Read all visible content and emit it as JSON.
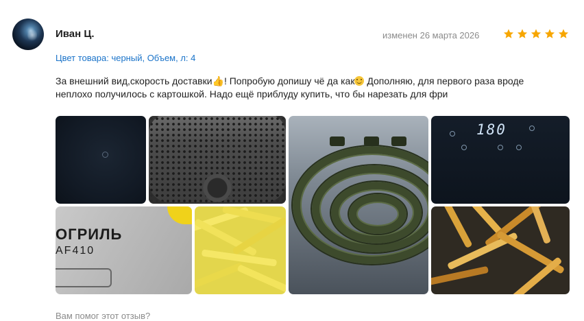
{
  "review": {
    "author": "Иван Ц.",
    "edited": "изменен 26 марта 2026",
    "rating": 5,
    "variant": "Цвет товара: черный, Объем, л: 4",
    "text_part1": "За внешний вид,скорость доставки",
    "text_part2": "! Попробую допишу чё да как",
    "text_part3": " Дополняю, для первого раза вроде неплохо получилось с картошкой. Надо ещё приблуду купить, что бы нарезать для фри",
    "emoji_1": "👍",
    "emoji_2": "smiling-face"
  },
  "photos": {
    "display_digits": "180",
    "brand_text": "ОГРИЛЬ",
    "model_text": "AF410"
  },
  "footer": {
    "helpful_question": "Вам помог этот отзыв?"
  },
  "colors": {
    "star": "#f7a600",
    "link": "#1a73c9",
    "muted": "#8b8b8b"
  }
}
